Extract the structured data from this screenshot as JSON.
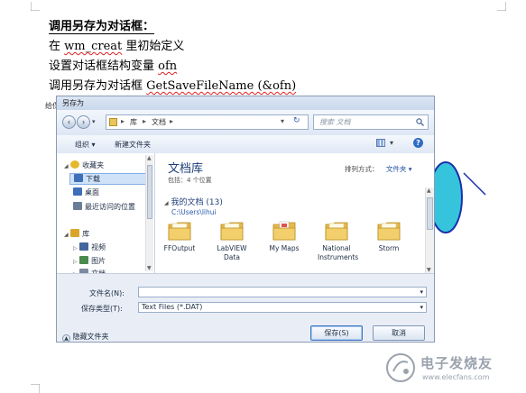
{
  "document": {
    "heading": "调用另存为对话框：",
    "line1_prefix": "在 ",
    "line1_func": "wm_creat",
    "line1_suffix": " 里初始定义",
    "line2_prefix": "设置对话框结构变量 ",
    "line2_var": "ofn",
    "line3_prefix": "调用另存为对话框 ",
    "line3_call": "GetSaveFileName (&ofn)",
    "side_fragment": "给保"
  },
  "dialog": {
    "title": "另存为",
    "address_path": [
      "库",
      "文档"
    ],
    "search_placeholder": "搜索 文档",
    "toolbar": {
      "organize": "组织 ▾",
      "new_folder": "新建文件夹"
    },
    "nav_items": [
      {
        "label": "收藏夹",
        "icon": "star-icon",
        "color": "#e5b72a"
      },
      {
        "label": "下载",
        "icon": "download-folder-icon",
        "color": "#3e6fb8"
      },
      {
        "label": "桌面",
        "icon": "desktop-icon",
        "color": "#3e6fb8"
      },
      {
        "label": "最近访问的位置",
        "icon": "recent-places-icon",
        "color": "#6a7d99"
      },
      {
        "label": "库",
        "icon": "library-icon",
        "color": "#d9a52a"
      },
      {
        "label": "视频",
        "icon": "video-icon",
        "color": "#42669e"
      },
      {
        "label": "图片",
        "icon": "pictures-icon",
        "color": "#4a8a4e"
      },
      {
        "label": "文档",
        "icon": "documents-icon",
        "color": "#7c8aa1"
      }
    ],
    "library": {
      "title": "文档库",
      "includes": "包括：4 个位置",
      "arrange_label": "排列方式：",
      "arrange_value": "文件夹 ▾",
      "section_label": "我的文档 (13)",
      "section_path": "C:\\Users\\lihui"
    },
    "folders": [
      "FFOutput",
      "LabVIEW Data",
      "My Maps",
      "National Instruments",
      "Storm"
    ],
    "filename_label": "文件名(N):",
    "filename_value": "",
    "savetype_label": "保存类型(T):",
    "savetype_value": "Text Files (*.DAT)",
    "hide_folders": "隐藏文件夹",
    "save_button": "保存(S)",
    "cancel_button": "取消"
  },
  "watermark": {
    "brand": "电子发烧友",
    "url": "www.elecfans.com"
  },
  "colors": {
    "accent": "#1e3f7a",
    "shape_fill": "#35c4dc",
    "squiggle": "#e02020"
  }
}
